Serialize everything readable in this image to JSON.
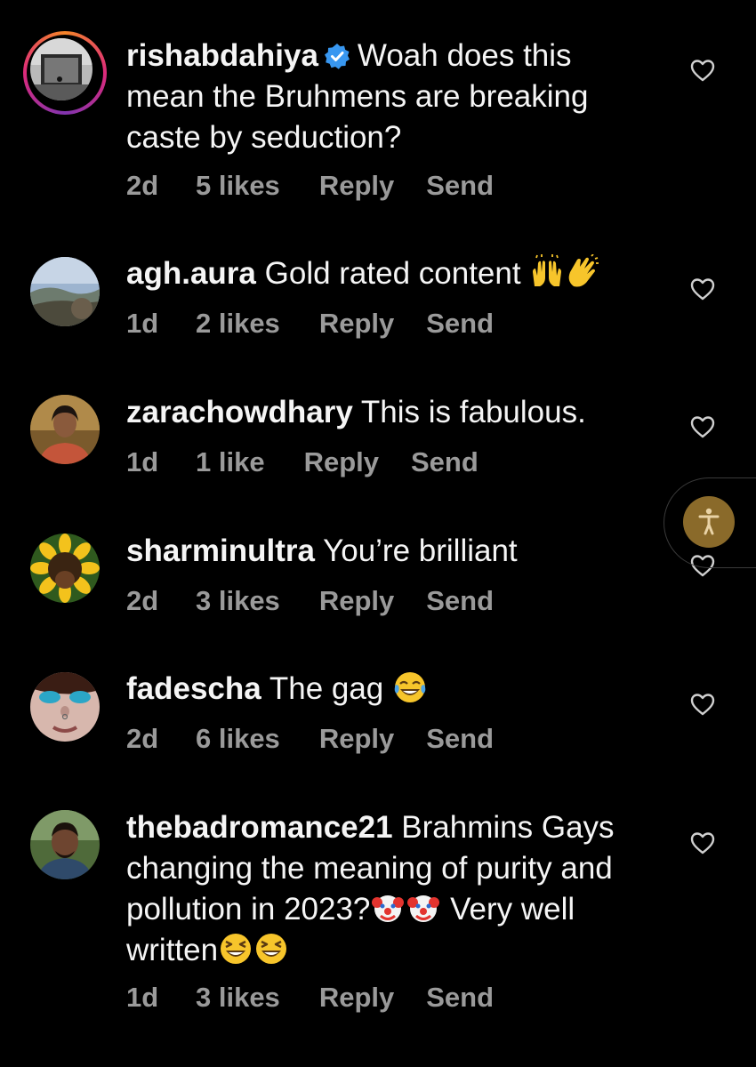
{
  "comments": [
    {
      "username": "rishabdahiya",
      "verified": true,
      "text_line1": "Woah does this",
      "text_rest": "mean the Bruhmens are breaking caste by seduction?",
      "age": "2d",
      "likes": "5 likes",
      "reply": "Reply",
      "send": "Send"
    },
    {
      "username": "agh.aura",
      "text": "Gold rated content",
      "age": "1d",
      "likes": "2 likes",
      "reply": "Reply",
      "send": "Send"
    },
    {
      "username": "zarachowdhary",
      "text": "This is fabulous.",
      "age": "1d",
      "likes": "1 like",
      "reply": "Reply",
      "send": "Send"
    },
    {
      "username": "sharminultra",
      "text": "You’re brilliant",
      "age": "2d",
      "likes": "3 likes",
      "reply": "Reply",
      "send": "Send"
    },
    {
      "username": "fadescha",
      "text": "The gag",
      "age": "2d",
      "likes": "6 likes",
      "reply": "Reply",
      "send": "Send"
    },
    {
      "username": "thebadromance21",
      "text_line1": "Brahmins Gays",
      "text_line2": "changing the meaning of purity and",
      "text_line3a": "pollution in 2023?",
      "text_line3b": "Very well",
      "text_line4": "written",
      "age": "1d",
      "likes": "3 likes",
      "reply": "Reply",
      "send": "Send"
    }
  ],
  "icons": {
    "like": "heart-outline-icon",
    "verified": "verified-badge-icon",
    "accessibility": "accessibility-icon"
  },
  "colors": {
    "background": "#000000",
    "text": "#f5f5f5",
    "meta": "#9a9a9a",
    "verified": "#3897f0"
  }
}
